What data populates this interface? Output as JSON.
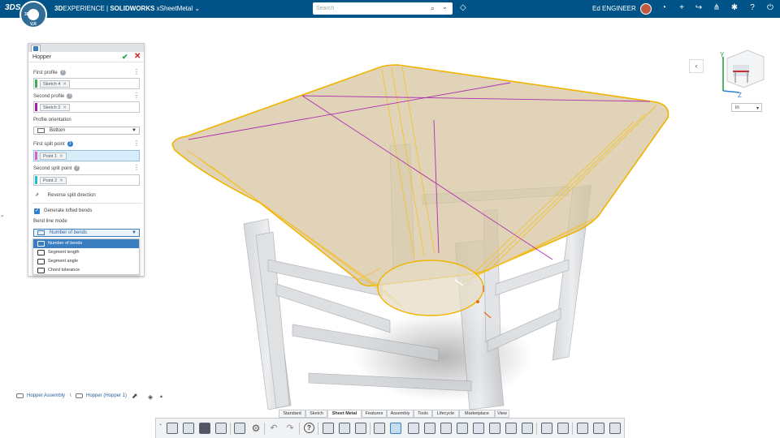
{
  "topbar": {
    "logo": "3DS",
    "compass_top": "3D",
    "compass_bottom": "V,R",
    "brand_bold": "3D",
    "brand_rest": "EXPERIENCE | ",
    "brand_product": "SOLIDWORKS",
    "brand_app": " xSheetMetal ",
    "search_placeholder": "Search",
    "username": "Ed ENGINEER"
  },
  "panel": {
    "title": "Hopper",
    "first_profile_label": "First profile",
    "first_profile_value": "Sketch 4",
    "first_profile_info": "?",
    "second_profile_label": "Second profile",
    "second_profile_value": "Sketch 2",
    "second_profile_info": "?",
    "orientation_label": "Profile orientation",
    "orientation_value": "Bottom",
    "first_split_label": "First split point",
    "first_split_value": "Point 1",
    "first_split_info": "1",
    "second_split_label": "Second split point",
    "second_split_value": "Point 2",
    "second_split_info": "?",
    "reverse_label": "Reverse split direction",
    "generate_label": "Generate lofted bends",
    "generate_checked": true,
    "bend_mode_label": "Bend line mode",
    "bend_mode_value": "Number of bends",
    "bend_mode_options": [
      "Number of bends",
      "Segment length",
      "Segment angle",
      "Chord tolerance"
    ],
    "colors": {
      "first_profile": "#3fb050",
      "second_profile": "#a020a0",
      "first_split": "#e060c0",
      "second_split": "#20c0d8"
    }
  },
  "viewport": {
    "units": "in",
    "triad_y": "Y",
    "triad_z": "Z"
  },
  "breadcrumb": {
    "assembly": "Hopper Assembly",
    "separator": "\\",
    "part": "Hopper (Hopper 1)"
  },
  "tabs": [
    "Standard",
    "Sketch",
    "Sheet Metal",
    "Features",
    "Assembly",
    "Tools",
    "Lifecycle",
    "Marketplace",
    "View"
  ],
  "active_tab": "Sheet Metal",
  "colors": {
    "topbar": "#005386",
    "accent": "#3b7ec0",
    "hopper_edge": "#f2b800",
    "hopper_fill": "#d8c8a4"
  }
}
